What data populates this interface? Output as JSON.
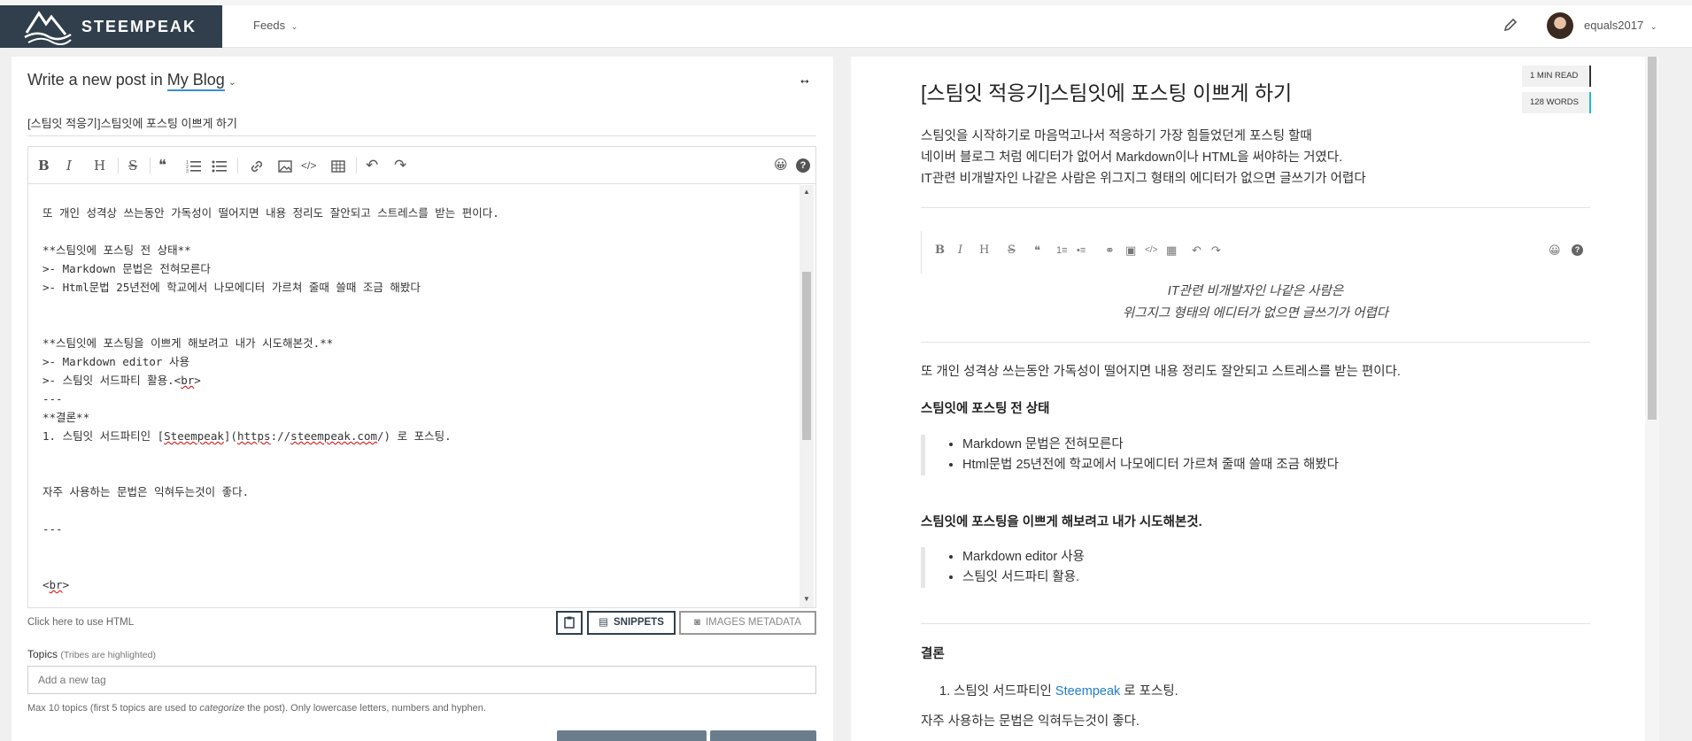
{
  "app": {
    "brand": "STEEMPEAK",
    "feeds_label": "Feeds",
    "username": "equals2017"
  },
  "editor": {
    "heading_prefix": "Write a new post in",
    "blog_name": "My Blog",
    "title_value": "[스팀잇 적응기]스팀잇에 포스팅 이쁘게 하기",
    "code_lines": [
      "",
      "또 개인 성격상 쓰는동안 가독성이 떨어지면 내용 정리도 잘안되고 스트레스를 받는 편이다.",
      "",
      "**스팀잇에 포스팅 전 상태**",
      ">- Markdown 문법은 전혀모른다",
      ">- Html문법 25년전에 학교에서 나모에디터 가르쳐 줄때 쓸때 조금 해봤다",
      "",
      "",
      "**스팀잇에 포스팅을 이쁘게 해보려고 내가 시도해본것.**",
      ">- Markdown editor 사용",
      ">- 스팀잇 서드파티 활용.<br>",
      "---",
      "**결론**",
      "1. 스팀잇 서드파티인 [Steempeak](https://steempeak.com/) 로 포스팅.",
      "",
      "",
      "자주 사용하는 문법은 익혀두는것이 좋다.",
      "",
      "---",
      "",
      "",
      "<br>"
    ],
    "html_toggle": "Click here to use HTML",
    "snippets_label": "SNIPPETS",
    "images_metadata_label": "IMAGES METADATA",
    "topics_label": "Topics",
    "topics_hint": "(Tribes are highlighted)",
    "tag_placeholder": "Add a new tag",
    "topics_note_1": "Max 10 topics (first 5 topics are used to ",
    "topics_note_em": "categorize",
    "topics_note_2": " the post). Only lowercase letters, numbers and hyphen."
  },
  "preview": {
    "read_time": "1 MIN READ",
    "word_count": "128 WORDS",
    "title": "[스팀잇 적응기]스팀잇에 포스팅 이쁘게 하기",
    "intro_lines": [
      "스팀잇을 시작하기로 마음먹고나서 적응하기 가장 힘들었던게 포스팅 할때",
      "네이버 블로그 처럼 에디터가 없어서 Markdown이나 HTML을 써야하는 거였다.",
      "IT관련 비개발자인 나같은 사람은 위그지그 형태의 에디터가 없으면 글쓰기가 어렵다"
    ],
    "center_lines": [
      "IT관련 비개발자인 나같은 사람은",
      "위그지그 형태의 에디터가 없으면 글쓰기가 어렵다"
    ],
    "para_1": "또 개인 성격상 쓰는동안 가독성이 떨어지면 내용 정리도 잘안되고 스트레스를 받는 편이다.",
    "heading_1": "스팀잇에 포스팅 전 상태",
    "list_1": [
      "Markdown 문법은 전혀모른다",
      "Html문법 25년전에 학교에서 나모에디터 가르쳐 줄때 쓸때 조금 해봤다"
    ],
    "heading_2": "스팀잇에 포스팅을 이쁘게 해보려고 내가 시도해본것.",
    "list_2": [
      "Markdown editor 사용",
      "스팀잇 서드파티 활용."
    ],
    "heading_3": "결론",
    "ol_prefix": "1. 스팀잇 서드파티인 ",
    "ol_link": "Steempeak",
    "ol_suffix": " 로 포스팅.",
    "para_2": "자주 사용하는 문법은 익혀두는것이 좋다."
  },
  "icons": {
    "bold": "B",
    "italic": "I",
    "heading": "H",
    "strike": "S",
    "quote": "❝",
    "emoji": "😀",
    "help": "?"
  }
}
